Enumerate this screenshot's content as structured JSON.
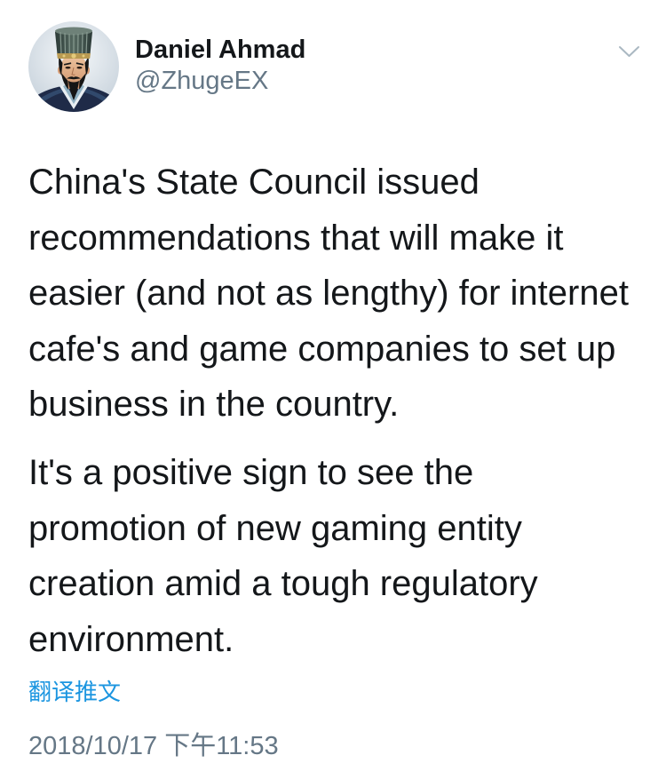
{
  "user": {
    "name": "Daniel Ahmad",
    "handle": "@ZhugeEX",
    "avatar_icon": "avatar-portrait-icon"
  },
  "menu": {
    "icon": "chevron-down-icon"
  },
  "tweet": {
    "paragraphs": [
      {
        "lines": [
          "China's State Council issued",
          "recommendations that will make it",
          "easier (and not as lengthy) for internet",
          "cafe's and game companies to set up",
          "business in the country."
        ]
      },
      {
        "lines": [
          "It's a positive sign to see the",
          "promotion of new gaming entity",
          "creation amid a tough regulatory",
          "environment."
        ]
      }
    ],
    "translate_label": "翻译推文",
    "timestamp": "2018/10/17 下午11:53"
  },
  "colors": {
    "text": "#14171a",
    "secondary": "#657786",
    "link": "#1b95e0",
    "chevron": "#aab8c2",
    "background": "#ffffff"
  }
}
